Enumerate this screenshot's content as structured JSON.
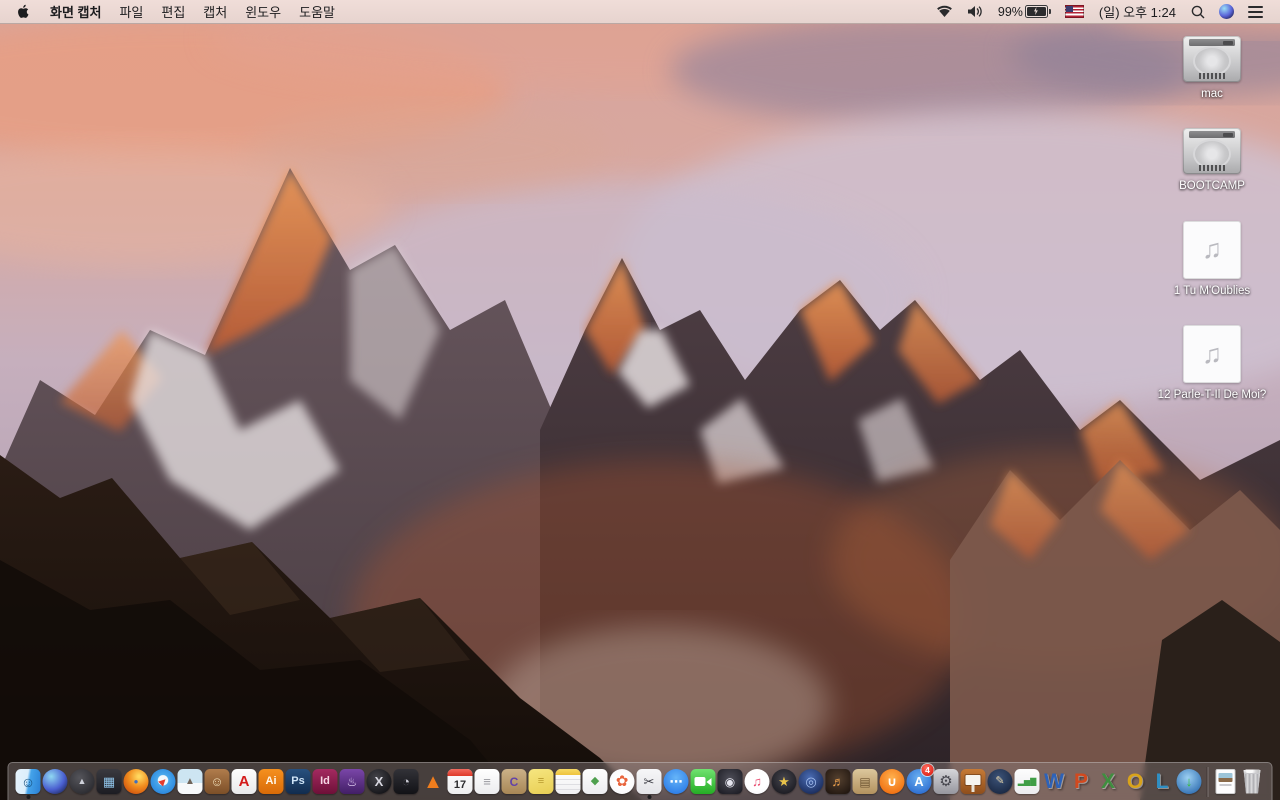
{
  "menu_bar": {
    "app_name": "화면 캡처",
    "menus": [
      "파일",
      "편집",
      "캡처",
      "윈도우",
      "도움말"
    ],
    "status": {
      "battery_percent": "99%",
      "clock": "(일) 오후 1:24",
      "icons": [
        "wifi-icon",
        "volume-icon",
        "battery-charging-icon",
        "us-flag-icon",
        "spotlight-icon",
        "siri-icon",
        "notification-center-icon"
      ]
    }
  },
  "desktop": {
    "icons": [
      {
        "label": "mac",
        "type": "drive"
      },
      {
        "label": "BOOTCAMP",
        "type": "drive"
      },
      {
        "label": "1 Tu M'Oublies",
        "type": "audio"
      },
      {
        "label": "12 Parle-T-Il De Moi?",
        "type": "audio"
      }
    ]
  },
  "dock": {
    "items": [
      {
        "name": "finder",
        "label": "Finder",
        "shape": "rounded",
        "bg": "linear-gradient(100deg,#e6f3fc 0%,#dceefb 45%,#44a3ea 55%,#2a7fd4 100%)",
        "glyph": "☺",
        "fg": "#17507e",
        "fs": 14,
        "running": true
      },
      {
        "name": "siri",
        "label": "Siri",
        "shape": "circle",
        "bg": "radial-gradient(circle at 35% 30%,#8fd8f2,#4a5fd0 55%,#141c3e 95%)"
      },
      {
        "name": "launchpad",
        "label": "Launchpad",
        "shape": "circle",
        "bg": "radial-gradient(circle at 40% 35%,#55555b,#2b2b30 80%)",
        "glyph": "▲",
        "fg": "#cfd2da",
        "fs": 9
      },
      {
        "name": "mission-control",
        "label": "Mission Control",
        "shape": "rounded",
        "bg": "linear-gradient(180deg,#3a3a40,#1c1c22)",
        "glyph": "▦",
        "fg": "#8fc3e8",
        "fs": 13
      },
      {
        "name": "firefox",
        "label": "Firefox",
        "shape": "circle",
        "bg": "radial-gradient(circle at 62% 30%,#ffd75e 5%,#f08c1e 45%,#d2570f 80%)",
        "glyph": "●",
        "fg": "#3f6fc0",
        "fs": 8
      },
      {
        "name": "safari",
        "label": "Safari",
        "shape": "circle",
        "bg": "radial-gradient(circle at 50% 45%,#f2f8fc 0 26%,#49a8ec 30%,#1f7ad8 95%)",
        "glyph": "▶",
        "fg": "#e43c2e",
        "fs": 9,
        "rot": -45
      },
      {
        "name": "preview",
        "label": "Preview",
        "shape": "rounded",
        "bg": "linear-gradient(180deg,#cde5f2 0 55%,#f7f9fa 55%)",
        "glyph": "▲",
        "fg": "#70655a",
        "fs": 10
      },
      {
        "name": "contacts",
        "label": "Contacts",
        "shape": "rounded",
        "bg": "linear-gradient(180deg,#b07c4c,#7c4f28)",
        "glyph": "☺",
        "fg": "#ecd9b4",
        "fs": 13
      },
      {
        "name": "acrobat",
        "label": "Adobe Acrobat Reader",
        "shape": "rounded",
        "bg": "linear-gradient(180deg,#fdfdfd,#e9e9ea)",
        "glyph": "A",
        "fg": "#d41a1a",
        "fs": 15,
        "fw": 700
      },
      {
        "name": "illustrator",
        "label": "Adobe Illustrator",
        "shape": "rounded",
        "bg": "linear-gradient(180deg,#f5901e,#d96b08)",
        "glyph": "Ai",
        "fg": "#fff7ea",
        "fs": 11,
        "fw": 700
      },
      {
        "name": "photoshop",
        "label": "Adobe Photoshop",
        "shape": "rounded",
        "bg": "linear-gradient(180deg,#27507e,#122c4e)",
        "glyph": "Ps",
        "fg": "#cfe4f7",
        "fs": 11,
        "fw": 700
      },
      {
        "name": "indesign",
        "label": "Adobe InDesign",
        "shape": "rounded",
        "bg": "linear-gradient(180deg,#a42a60,#6e1038)",
        "glyph": "Id",
        "fg": "#f7d7e4",
        "fs": 11,
        "fw": 700
      },
      {
        "name": "toast",
        "label": "Toast",
        "shape": "rounded",
        "bg": "linear-gradient(180deg,#7a46a8,#421f66)",
        "glyph": "♨",
        "fg": "#ead9fb",
        "fs": 12
      },
      {
        "name": "xquartz",
        "label": "XQuartz",
        "shape": "circle",
        "bg": "radial-gradient(circle at 40% 35%,#44444a,#101014 85%)",
        "glyph": "X",
        "fg": "#d9d9e2",
        "fs": 13,
        "fw": 700
      },
      {
        "name": "disk-speed",
        "label": "Disk Speed Test",
        "shape": "rounded",
        "bg": "linear-gradient(180deg,#323238,#121216)",
        "glyph": "◔",
        "fg": "#c9c9d2",
        "fs": 13
      },
      {
        "name": "vlc",
        "label": "VLC",
        "shape": "none",
        "glyph": "▲",
        "fg": "#ef7d1d",
        "fs": 20
      },
      {
        "name": "calendar",
        "label": "Calendar",
        "type": "calendar",
        "day": "17"
      },
      {
        "name": "reminders",
        "label": "Reminders",
        "shape": "rounded",
        "bg": "linear-gradient(180deg,#ffffff,#ececee)",
        "glyph": "≡",
        "fg": "#9a9aa0",
        "fs": 13
      },
      {
        "name": "stuffit",
        "label": "StuffIt Expander",
        "shape": "rounded",
        "bg": "linear-gradient(180deg,#cbb188,#a88756)",
        "glyph": "C",
        "fg": "#6242a8",
        "fs": 12,
        "fw": 700
      },
      {
        "name": "stickies",
        "label": "Stickies",
        "shape": "rounded",
        "bg": "linear-gradient(165deg,#f6e680,#e8ce54)",
        "glyph": "≡",
        "fg": "#b89a2e",
        "fs": 11
      },
      {
        "name": "notes",
        "label": "Notes",
        "type": "notes"
      },
      {
        "name": "color-cards",
        "label": "Graphics Utility",
        "shape": "rounded",
        "bg": "linear-gradient(180deg,#fdfdfd,#ededf0)",
        "glyph": "◆",
        "fg": "#4fa04e",
        "fs": 11
      },
      {
        "name": "photos",
        "label": "Photos",
        "shape": "circle",
        "bg": "radial-gradient(circle at 50% 50%,#ffffff 0 30%,#f6f6f8 100%)",
        "glyph": "✿",
        "fg": "#e8643c",
        "fs": 15
      },
      {
        "name": "grab",
        "label": "화면 캡처",
        "shape": "rounded",
        "bg": "linear-gradient(180deg,#f6f6f8,#e4e4e8)",
        "glyph": "✂",
        "fg": "#3c3c44",
        "fs": 13,
        "running": true
      },
      {
        "name": "messages",
        "label": "Messages",
        "shape": "circle",
        "bg": "radial-gradient(circle at 50% 35%,#66b5f8,#2a7ae6 85%)",
        "glyph": "⋯",
        "fg": "#ffffff",
        "fs": 13,
        "fw": 700
      },
      {
        "name": "facetime",
        "label": "FaceTime",
        "type": "facetime",
        "shape": "rounded",
        "bg": "linear-gradient(180deg,#6fe26f,#25ad25)"
      },
      {
        "name": "photo-booth",
        "label": "Photo Booth",
        "shape": "rounded",
        "bg": "radial-gradient(circle at 50% 40%,#4e4e58,#1c1c24 90%)",
        "glyph": "◉",
        "fg": "#e4e4ee",
        "fs": 12
      },
      {
        "name": "itunes",
        "label": "iTunes",
        "shape": "circle",
        "bg": "radial-gradient(circle at 50% 40%,#ffffff 0 55%,#f2f2f6 100%)",
        "glyph": "♫",
        "fg": "#e84a6e",
        "fs": 13
      },
      {
        "name": "imovie",
        "label": "iMovie",
        "shape": "circle",
        "bg": "radial-gradient(circle at 50% 40%,#46464e,#16161c 90%)",
        "glyph": "★",
        "fg": "#e8c34a",
        "fs": 13
      },
      {
        "name": "idvd",
        "label": "iDVD",
        "shape": "circle",
        "bg": "radial-gradient(circle at 45% 35%,#4a6cb4,#142450 90%)",
        "glyph": "◎",
        "fg": "#a4bff0",
        "fs": 13
      },
      {
        "name": "garageband",
        "label": "GarageBand",
        "shape": "rounded",
        "bg": "radial-gradient(circle at 50% 40%,#54402f,#201610 90%)",
        "glyph": "♬",
        "fg": "#eda04c",
        "fs": 13
      },
      {
        "name": "newsstand",
        "label": "News Bundle",
        "shape": "rounded",
        "bg": "linear-gradient(180deg,#dcc79c,#b3925f)",
        "glyph": "▤",
        "fg": "#6e5532",
        "fs": 12
      },
      {
        "name": "ibooks",
        "label": "iBooks",
        "shape": "circle",
        "bg": "radial-gradient(circle at 50% 35%,#ffb14e,#ef6c0e 85%)",
        "glyph": "∪",
        "fg": "#ffffff",
        "fs": 13,
        "fw": 700
      },
      {
        "name": "app-store",
        "label": "App Store",
        "shape": "circle",
        "bg": "radial-gradient(circle at 50% 35%,#6cb2f2,#2a6ace 85%)",
        "glyph": "A",
        "fg": "#ffffff",
        "fs": 13,
        "fw": 700,
        "badge": "4"
      },
      {
        "name": "system-preferences",
        "label": "System Preferences",
        "shape": "rounded",
        "bg": "linear-gradient(180deg,#d6d6da,#96969e)",
        "glyph": "⚙",
        "fg": "#46464e",
        "fs": 15
      },
      {
        "name": "keynote",
        "label": "Keynote",
        "type": "keynote",
        "shape": "rounded",
        "bg": "linear-gradient(180deg,#c67a36,#8e4e1c)"
      },
      {
        "name": "pages",
        "label": "Pages",
        "shape": "circle",
        "bg": "radial-gradient(circle at 45% 35%,#3c5378,#16233c 90%)",
        "glyph": "✎",
        "fg": "#e9d8ae",
        "fs": 11
      },
      {
        "name": "numbers",
        "label": "Numbers",
        "shape": "rounded",
        "bg": "linear-gradient(180deg,#fdfdfd,#ececef)",
        "glyph": "▂▅▇",
        "fg": "#3f9e46",
        "fs": 8
      },
      {
        "name": "ms-word",
        "label": "Microsoft Word",
        "type": "letter",
        "glyph": "W",
        "fg": "#2d62b8"
      },
      {
        "name": "ms-powerpoint",
        "label": "Microsoft PowerPoint",
        "type": "letter",
        "glyph": "P",
        "fg": "#d2491e"
      },
      {
        "name": "ms-excel",
        "label": "Microsoft Excel",
        "type": "letter",
        "glyph": "X",
        "fg": "#3f8e3f"
      },
      {
        "name": "ms-outlook",
        "label": "Microsoft Outlook",
        "type": "letter",
        "glyph": "O",
        "fg": "#d9a31a"
      },
      {
        "name": "ms-lync",
        "label": "Microsoft Lync",
        "type": "letter",
        "glyph": "L",
        "fg": "#2f8fc4"
      },
      {
        "name": "globe-download",
        "label": "Internet Download",
        "shape": "circle",
        "bg": "radial-gradient(circle at 45% 35%,#9cd0f2,#2d6cb0 85%)",
        "glyph": "↓",
        "fg": "#35c035",
        "fs": 13,
        "fw": 700
      },
      {
        "name": "divider",
        "type": "divider"
      },
      {
        "name": "document",
        "label": "Document",
        "type": "doc"
      },
      {
        "name": "trash",
        "label": "Trash",
        "type": "trash"
      }
    ]
  }
}
